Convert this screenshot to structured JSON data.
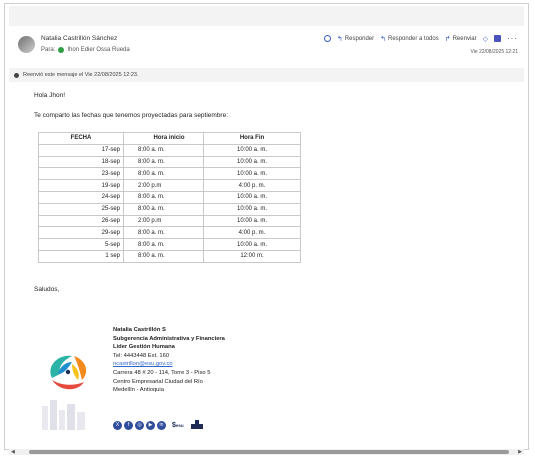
{
  "header": {
    "sender_name": "Natalia Castrillón Sánchez",
    "to_label": "Para:",
    "to_name": "Ihon Edier Ossa Rueda",
    "reply_label": "Responder",
    "reply_all_label": "Responder a todos",
    "forward_label": "Reenviar",
    "more_label": "···",
    "date": "Vie 22/08/2025 12:21"
  },
  "forward_notice": "Reenvió este mensaje el Vie 22/08/2025 12:23.",
  "message": {
    "greeting": "Hola Jhon!",
    "intro": "Te comparto las fechas que tenemos proyectadas para septiembre:",
    "table": {
      "headers": [
        "FECHA",
        "Hora inicio",
        "Hora Fin"
      ],
      "rows": [
        [
          "17-sep",
          "8:00 a. m.",
          "10:00 a. m."
        ],
        [
          "18-sep",
          "8:00 a. m.",
          "10:00 a. m."
        ],
        [
          "23-sep",
          "8:00 a. m.",
          "10:00 a. m."
        ],
        [
          "19-sep",
          "2:00 p.m",
          "4:00 p. m."
        ],
        [
          "24-sep",
          "8:00 a. m.",
          "10:00 a. m."
        ],
        [
          "25-sep",
          "8:00 a. m.",
          "10:00 a. m."
        ],
        [
          "26-sep",
          "2:00 p.m",
          "10:00 a. m."
        ],
        [
          "29-sep",
          "8:00 a. m.",
          "4:00 p. m."
        ],
        [
          "5-sep",
          "8:00 a. m.",
          "10:00 a. m."
        ],
        [
          "1 sep",
          "8:00 a. m.",
          "12:00 m."
        ]
      ]
    },
    "closing": "Saludos,"
  },
  "signature": {
    "name": "Natalia Castrillón S",
    "dept": "Subgerencia Administrativa y Financiera",
    "role": "Líder Gestión Humana",
    "phone": "Tel: 4443448 Ext. 160",
    "email": "ncastrillon@esu.gov.co",
    "address": "Carrera 48 # 20 - 114, Torre 3 - Piso 5",
    "building": "Centro Empresarial Ciudad del Río",
    "city": "Medellín - Antioquia",
    "esu_logo_text": "$",
    "esu_sub": "esu"
  },
  "colors": {
    "accent": "#3a5ec8",
    "presence": "#2e9e45",
    "link": "#3366cc"
  },
  "icons": {
    "avatar": "avatar",
    "emoji": "smiley-icon",
    "reply": "reply-icon",
    "reply_all": "reply-all-icon",
    "forward": "forward-icon",
    "teams": "teams-icon"
  }
}
